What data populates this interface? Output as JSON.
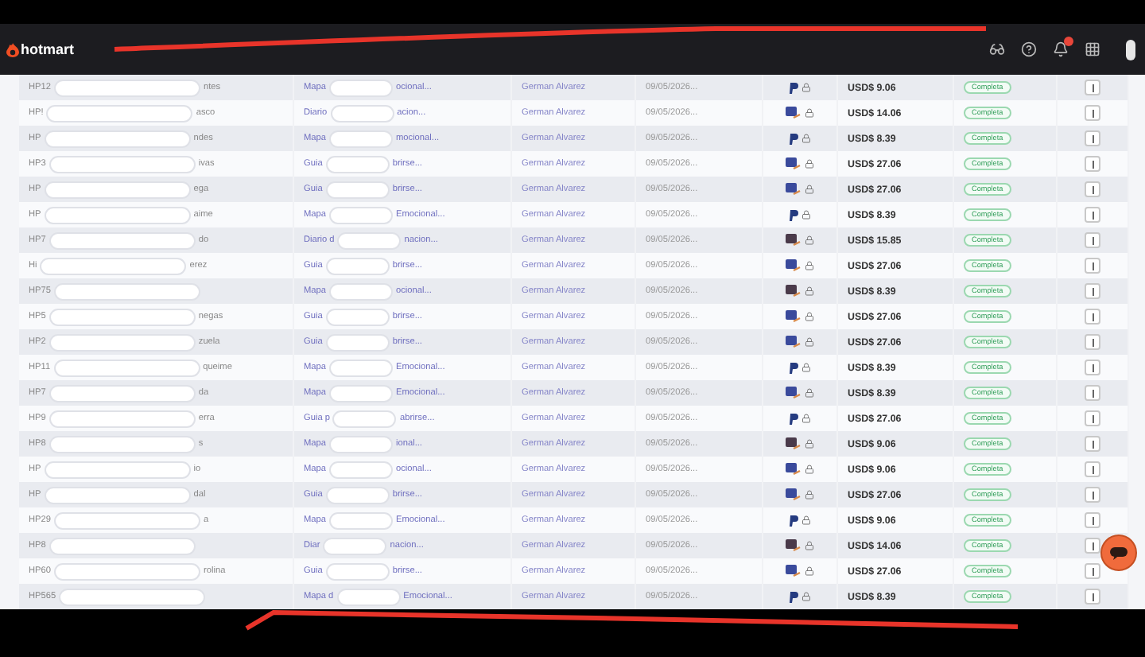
{
  "header": {
    "logo": "hotmart",
    "notifications_badge": true
  },
  "rows": [
    {
      "code": "HP12",
      "name_end": "ntes",
      "product_start": "Mapa",
      "product_end": "ocional...",
      "author": "German Alvarez",
      "date": "09/05/2026...",
      "kind": "paypal",
      "amount": "USD$ 9.06",
      "status": "Completa"
    },
    {
      "code": "HP!",
      "name_end": "asco",
      "product_start": "Diario",
      "product_end": "acion...",
      "author": "German Alvarez",
      "date": "09/05/2026...",
      "kind": "card",
      "amount": "USD$ 14.06",
      "status": "Completa"
    },
    {
      "code": "HP",
      "name_end": "ndes",
      "product_start": "Mapa",
      "product_end": "mocional...",
      "author": "German Alvarez",
      "date": "09/05/2026...",
      "kind": "paypal",
      "amount": "USD$ 8.39",
      "status": "Completa"
    },
    {
      "code": "HP3",
      "name_end": "ivas",
      "product_start": "Guia",
      "product_end": "brirse...",
      "author": "German Alvarez",
      "date": "09/05/2026...",
      "kind": "card",
      "amount": "USD$ 27.06",
      "status": "Completa"
    },
    {
      "code": "HP",
      "name_end": "ega",
      "product_start": "Guia",
      "product_end": "brirse...",
      "author": "German Alvarez",
      "date": "09/05/2026...",
      "kind": "card",
      "amount": "USD$ 27.06",
      "status": "Completa"
    },
    {
      "code": "HP",
      "name_end": "aime",
      "product_start": "Mapa",
      "product_end": "Emocional...",
      "author": "German Alvarez",
      "date": "09/05/2026...",
      "kind": "paypal",
      "amount": "USD$ 8.39",
      "status": "Completa"
    },
    {
      "code": "HP7",
      "name_end": "do",
      "product_start": "Diario d",
      "product_end": "nacion...",
      "author": "German Alvarez",
      "date": "09/05/2026...",
      "kind": "card_dark",
      "amount": "USD$ 15.85",
      "status": "Completa"
    },
    {
      "code": "Hi",
      "name_end": "erez",
      "product_start": "Guia",
      "product_end": "brirse...",
      "author": "German Alvarez",
      "date": "09/05/2026...",
      "kind": "card",
      "amount": "USD$ 27.06",
      "status": "Completa"
    },
    {
      "code": "HP75",
      "product_start": "Mapa",
      "product_end": "ocional...",
      "author": "German Alvarez",
      "date": "09/05/2026...",
      "kind": "card_dark",
      "amount": "USD$ 8.39",
      "status": "Completa"
    },
    {
      "code": "HP5",
      "name_end": "negas",
      "product_start": "Guia",
      "product_end": "brirse...",
      "author": "German Alvarez",
      "date": "09/05/2026...",
      "kind": "card",
      "amount": "USD$ 27.06",
      "status": "Completa"
    },
    {
      "code": "HP2",
      "name_end": "zuela",
      "product_start": "Guia",
      "product_end": "brirse...",
      "author": "German Alvarez",
      "date": "09/05/2026...",
      "kind": "card",
      "amount": "USD$ 27.06",
      "status": "Completa"
    },
    {
      "code": "HP11",
      "name_end": "queime",
      "product_start": "Mapa",
      "product_end": "Emocional...",
      "author": "German Alvarez",
      "date": "09/05/2026...",
      "kind": "paypal",
      "amount": "USD$ 8.39",
      "status": "Completa"
    },
    {
      "code": "HP7",
      "name_end": "da",
      "product_start": "Mapa",
      "product_end": "Emocional...",
      "author": "German Alvarez",
      "date": "09/05/2026...",
      "kind": "card",
      "amount": "USD$ 8.39",
      "status": "Completa"
    },
    {
      "code": "HP9",
      "name_end": "erra",
      "product_start": "Guia p",
      "product_end": "abrirse...",
      "author": "German Alvarez",
      "date": "09/05/2026...",
      "kind": "paypal",
      "amount": "USD$ 27.06",
      "status": "Completa"
    },
    {
      "code": "HP8",
      "name_end": "s",
      "product_start": "Mapa",
      "product_end": "ional...",
      "author": "German Alvarez",
      "date": "09/05/2026...",
      "kind": "card_dark",
      "amount": "USD$ 9.06",
      "status": "Completa"
    },
    {
      "code": "HP",
      "name_end": "io",
      "product_start": "Mapa",
      "product_end": "ocional...",
      "author": "German Alvarez",
      "date": "09/05/2026...",
      "kind": "card",
      "amount": "USD$ 9.06",
      "status": "Completa"
    },
    {
      "code": "HP",
      "name_end": "dal",
      "product_start": "Guia",
      "product_end": "brirse...",
      "author": "German Alvarez",
      "date": "09/05/2026...",
      "kind": "card",
      "amount": "USD$ 27.06",
      "status": "Completa"
    },
    {
      "code": "HP29",
      "name_end": "a",
      "product_start": "Mapa",
      "product_end": "Emocional...",
      "author": "German Alvarez",
      "date": "09/05/2026...",
      "kind": "paypal",
      "amount": "USD$ 9.06",
      "status": "Completa"
    },
    {
      "code": "HP8",
      "product_start": "Diar",
      "product_end": "nacion...",
      "author": "German Alvarez",
      "date": "09/05/2026...",
      "kind": "card_dark",
      "amount": "USD$ 14.06",
      "status": "Completa"
    },
    {
      "code": "HP60",
      "name_end": "rolina",
      "product_start": "Guia",
      "product_end": "brirse...",
      "author": "German Alvarez",
      "date": "09/05/2026...",
      "kind": "card",
      "amount": "USD$ 27.06",
      "status": "Completa"
    },
    {
      "code": "HP565",
      "product_start": "Mapa d",
      "product_end": "Emocional...",
      "author": "German Alvarez",
      "date": "09/05/2026...",
      "kind": "paypal",
      "amount": "USD$ 8.39",
      "status": "Completa"
    }
  ]
}
